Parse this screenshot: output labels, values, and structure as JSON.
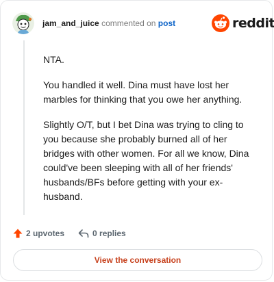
{
  "header": {
    "username": "jam_and_juice",
    "commented_on": "commented on",
    "post_link": "post"
  },
  "brand": {
    "name": "reddit",
    "icon": "reddit-alien-icon",
    "accent": "#ff4500"
  },
  "comment": {
    "paragraphs": [
      "NTA.",
      "You handled it well. Dina must have lost her marbles for thinking that you owe her anything.",
      "Slightly O/T, but I bet Dina was trying to cling to you because she probably burned all of her bridges with other women. For all we know, Dina could've been sleeping with all of her friends' husbands/BFs before getting with your ex-husband."
    ]
  },
  "actions": {
    "upvotes": "2 upvotes",
    "replies": "0 replies",
    "upvote_icon": "upvote-arrow-icon",
    "reply_icon": "reply-arrow-icon",
    "upvote_color": "#ff4500"
  },
  "cta": {
    "label": "View the conversation",
    "color": "#c7411d"
  }
}
